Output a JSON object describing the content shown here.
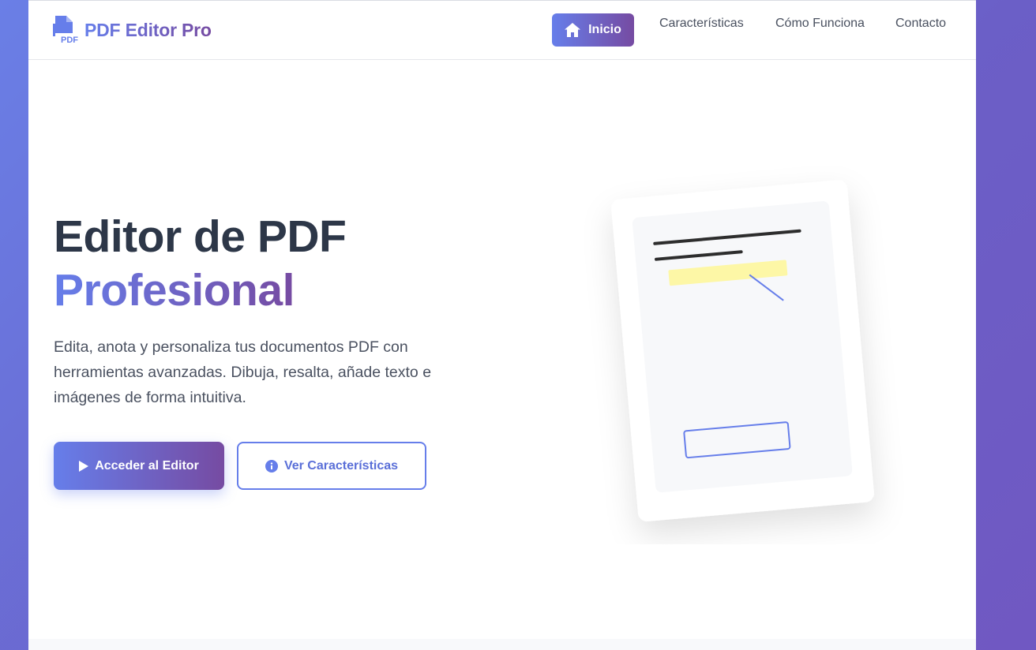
{
  "brand": {
    "name": "PDF Editor Pro",
    "icon": "pdf-file-icon",
    "icon_text": "PDF"
  },
  "nav": {
    "home_label": "Inicio",
    "home_icon": "home-icon",
    "links": [
      "Características",
      "Cómo Funciona",
      "Contacto"
    ]
  },
  "hero": {
    "title_line1": "Editor de PDF",
    "title_line2": "Profesional",
    "description": "Edita, anota y personaliza tus documentos PDF con herramientas avanzadas. Dibuja, resalta, añade texto e imágenes de forma intuitiva.",
    "primary_button": "Acceder al Editor",
    "primary_icon": "play-icon",
    "secondary_button": "Ver Características",
    "secondary_icon": "info-icon"
  },
  "illustration": {
    "name": "document-illustration"
  },
  "colors": {
    "accent_start": "#667eea",
    "accent_end": "#764ba2",
    "title_dark": "#2d3748",
    "highlight": "#fdf7a6"
  }
}
